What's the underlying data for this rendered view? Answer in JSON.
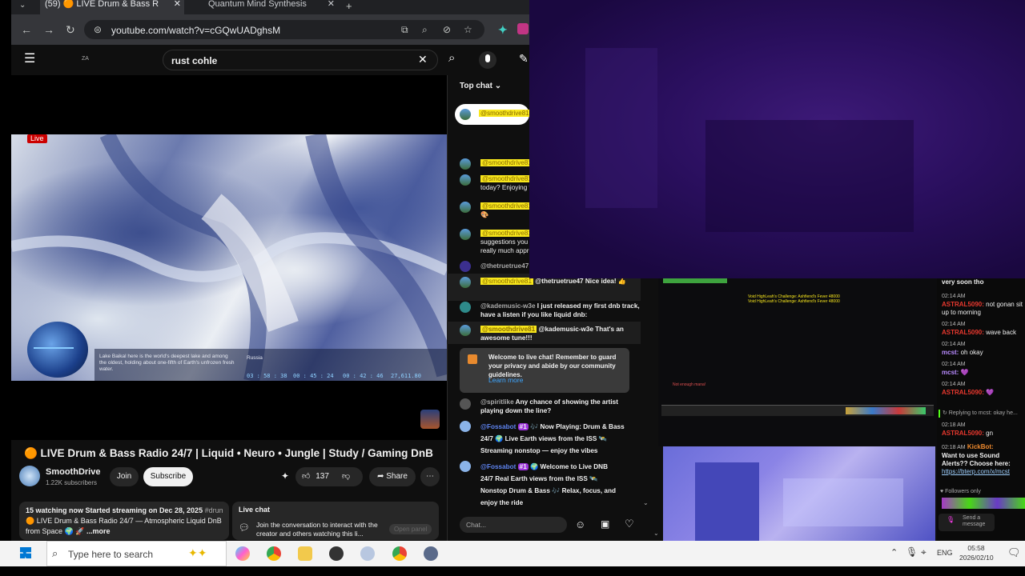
{
  "browser": {
    "tabs": [
      {
        "label": "(59) 🟠 LIVE Drum & Bass R",
        "active": true
      },
      {
        "label": "Quantum Mind Synthesis",
        "active": false
      }
    ],
    "url": "youtube.com/watch?v=cGQwUADghsM",
    "icons": {
      "back": "←",
      "forward": "→",
      "reload": "↻",
      "close": "✕",
      "new_tab": "+",
      "star": "☆",
      "zoom": "🔍"
    }
  },
  "youtube": {
    "logo_small": "ZA",
    "search_query": "rust cohle",
    "video": {
      "live_label": "Live",
      "overlay_text": "Lake Baikal here is the world's deepest lake and among the oldest, holding about one-fifth of Earth's unfrozen fresh water.",
      "region_label": "Russia",
      "stats": [
        "03 : 58 : 38",
        "00 : 45 : 24",
        "00 : 42 : 46",
        "27,611.80"
      ]
    },
    "title": "🟠 LIVE Drum & Bass Radio 24/7 | Liquid • Neuro • Jungle | Study / Gaming DnB",
    "channel": {
      "name": "SmoothDrive",
      "subscribers": "1.22K subscribers",
      "join_label": "Join",
      "subscribe_label": "Subscribe"
    },
    "likes": "137",
    "share_label": "Share",
    "more_label": "⋯",
    "description": {
      "line1": "15 watching now  Started streaming on Dec 28, 2025",
      "hashtag": "#drum",
      "line2": "🟠 LIVE Drum & Bass Radio 24/7 — Atmospheric Liquid DnB",
      "line3": "from Space 🌍 🚀",
      "more": "...more"
    },
    "livechat_panel": {
      "heading": "Live chat",
      "text": "Join the conversation to interact with the creator and others watching this li...",
      "button": "Open panel"
    }
  },
  "chat": {
    "header": "Top chat",
    "pinned_user": "@smoothdrive81",
    "messages": [
      {
        "user": "@smoothdrive81",
        "text": ""
      },
      {
        "user": "@smoothdrive81",
        "text": "today? Enjoying t"
      },
      {
        "user": "@smoothdrive81",
        "text": "🎨"
      },
      {
        "user": "@smoothdrive81",
        "text": "suggestions you really much appr"
      },
      {
        "user": "@thetruetrue47",
        "text": ""
      },
      {
        "user": "@smoothdrive81",
        "text": "@thetruetrue47 Nice idea! 👍"
      },
      {
        "user": "@kademusic-w3e",
        "text": "I just released my first dnb track, have a listen if you like liquid dnb:"
      },
      {
        "user": "@smoothdrive81",
        "text": "@kademusic-w3e That's an awesome tune!!!"
      }
    ],
    "welcome": {
      "text": "Welcome to live chat! Remember to guard your privacy and abide by our community guidelines.",
      "learn_more": "Learn more"
    },
    "later_messages": [
      {
        "user": "@spiritlike",
        "text": "Any chance of showing the artist playing down the line?"
      },
      {
        "user": "@Fossabot",
        "badge": "#1",
        "text": "🎶 Now Playing: Drum & Bass 24/7 🌍 Live Earth views from the ISS 🛰️ Streaming nonstop — enjoy the vibes"
      },
      {
        "user": "@Fossabot",
        "badge": "#1",
        "text": "🌍 Welcome to Live DNB 24/7 Real Earth views from the ISS 🛰️ Nonstop Drum & Bass 🎶 Relax, focus, and enjoy the ride"
      }
    ],
    "input_placeholder": "Chat..."
  },
  "stream_chat": {
    "top_text": "very soon tho",
    "messages": [
      {
        "time": "02:14 AM",
        "user": "ASTRAL5090:",
        "text": "not gonan sit up to morning"
      },
      {
        "time": "02:14 AM",
        "user": "ASTRAL5090:",
        "text": "wave back"
      },
      {
        "time": "02:14 AM",
        "user": "mcst:",
        "text": "oh okay"
      },
      {
        "time": "02:14 AM",
        "user": "mcst:",
        "text": "💜"
      },
      {
        "time": "02:14 AM",
        "user": "ASTRAL5090:",
        "text": "💜"
      }
    ],
    "reply_hint": "↻ Replying to mcst: okay he...",
    "reply": {
      "time": "02:18 AM",
      "user": "ASTRAL5090:",
      "text": "gn"
    },
    "bot": {
      "time": "02:18 AM",
      "user": "KickBot:",
      "text": "Want to use Sound Alerts?? Choose here:",
      "link": "https://bterp.com/x/mcst"
    },
    "followers_only": "Followers only",
    "send_label": "Send a message"
  },
  "game_overlay": {
    "lines": [
      "Void HighLeah's Challenge: Ashfiend's Fever 48000",
      "Void HighLeah's Challenge: Ashfiend's Fever 48000"
    ],
    "chat": "Not enough mana!"
  },
  "taskbar": {
    "search_placeholder": "Type here to search",
    "language": "ENG",
    "time": "05:58",
    "date": "2026/02/10"
  },
  "colors": {
    "youtube_red": "#cc0000",
    "subscribe_bg": "#f1f1f1",
    "purple_screen": "#2a0f5e",
    "superchat_yellow": "#f8e71c"
  }
}
